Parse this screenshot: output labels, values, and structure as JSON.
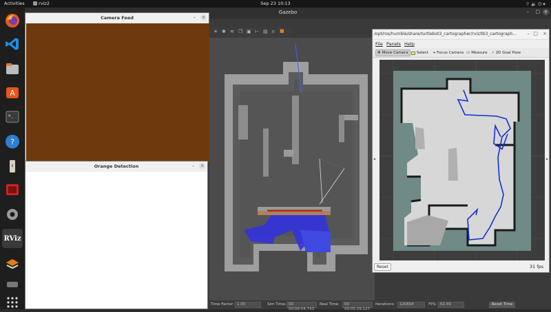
{
  "topbar": {
    "activities": "Activities",
    "app": "rviz2",
    "clock": "Sep 23  10:13"
  },
  "dock": {
    "items": [
      "firefox-icon",
      "vscode-icon",
      "files-icon",
      "app-store-icon",
      "terminal-icon",
      "help-icon",
      "usb-drive-icon",
      "media-icon",
      "settings-icon",
      "rviz-icon",
      "layers-icon",
      "drive-icon",
      "apps-grid-icon"
    ],
    "rviz_label": "RViz"
  },
  "gazebo": {
    "title": "Gazebo",
    "status": {
      "real_time_factor_label": "Time Factor:",
      "real_time_factor": "1.00",
      "sim_time_label": "Sim Time:",
      "sim_time": "00 00:06:54.733",
      "real_time_label": "Real Time:",
      "real_time": "00 00:05:29.127",
      "iterations_label": "Iterations:",
      "iterations": "120694",
      "fps_label": "FPS:",
      "fps": "62.49",
      "reset_label": "Reset Time"
    }
  },
  "camera_window": {
    "title": "Camera Feed",
    "min": "–",
    "close": "×"
  },
  "orange_window": {
    "title": "Orange Detection",
    "min": "–",
    "close": "×"
  },
  "rviz": {
    "title": "/opt/ros/humble/share/turtlebot3_cartographer/rviz/tb3_cartograph...",
    "menu": [
      "File",
      "Panels",
      "Help"
    ],
    "tools": [
      "Move Camera",
      "Select",
      "Focus Camera",
      "Measure",
      "2D Goal Pose"
    ],
    "reset": "Reset",
    "fps": "31 fps"
  }
}
